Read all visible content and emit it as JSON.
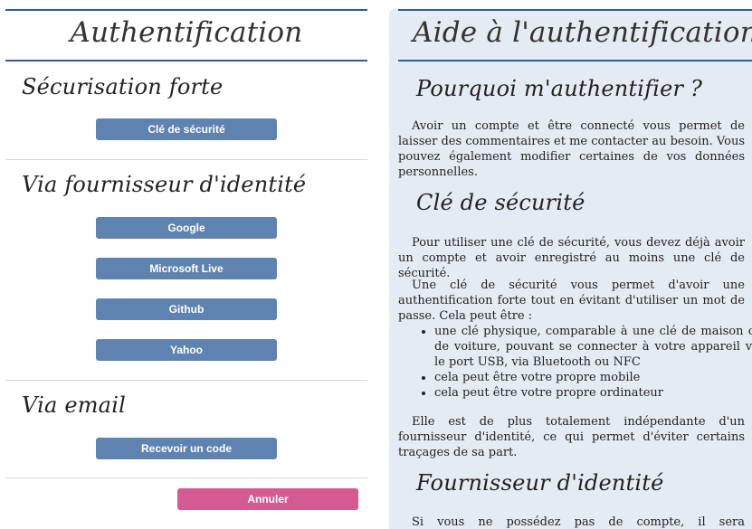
{
  "left": {
    "title": "Authentification",
    "sections": {
      "strong": {
        "title": "Sécurisation forte",
        "buttons": [
          "Clé de sécurité"
        ]
      },
      "provider": {
        "title": "Via fournisseur d'identité",
        "buttons": [
          "Google",
          "Microsoft Live",
          "Github",
          "Yahoo"
        ]
      },
      "email": {
        "title": "Via email",
        "buttons": [
          "Recevoir un code"
        ]
      }
    },
    "cancel_label": "Annuler"
  },
  "right": {
    "title": "Aide à l'authentification",
    "why_title": "Pourquoi m'authentifier ?",
    "why_text": "Avoir un compte et être connecté vous permet de laisser des commentaires et me contacter au besoin. Vous pouvez également modifier certaines de vos données personnelles.",
    "key_title": "Clé de sécurité",
    "key_text1": "Pour utiliser une clé de sécurité, vous devez déjà avoir un compte et avoir enregistré au moins une clé de sécurité.",
    "key_text2": "Une clé de sécurité vous permet d'avoir une authentification forte tout en évitant d'utiliser un mot de passe. Cela peut être :",
    "key_list": [
      "une clé physique, comparable à une clé de maison ou de voiture, pouvant se connecter à votre appareil via le port USB, via Bluetooth ou NFC",
      "cela peut être votre propre mobile",
      "cela peut être votre propre ordinateur"
    ],
    "key_text3": "Elle est de plus totalement indépendante d'un fournisseur d'identité, ce qui permet d'éviter certains traçages de sa part.",
    "provider_title": "Fournisseur d'identité",
    "provider_text": "Si vous ne possédez pas de compte, il sera automatiquement"
  }
}
